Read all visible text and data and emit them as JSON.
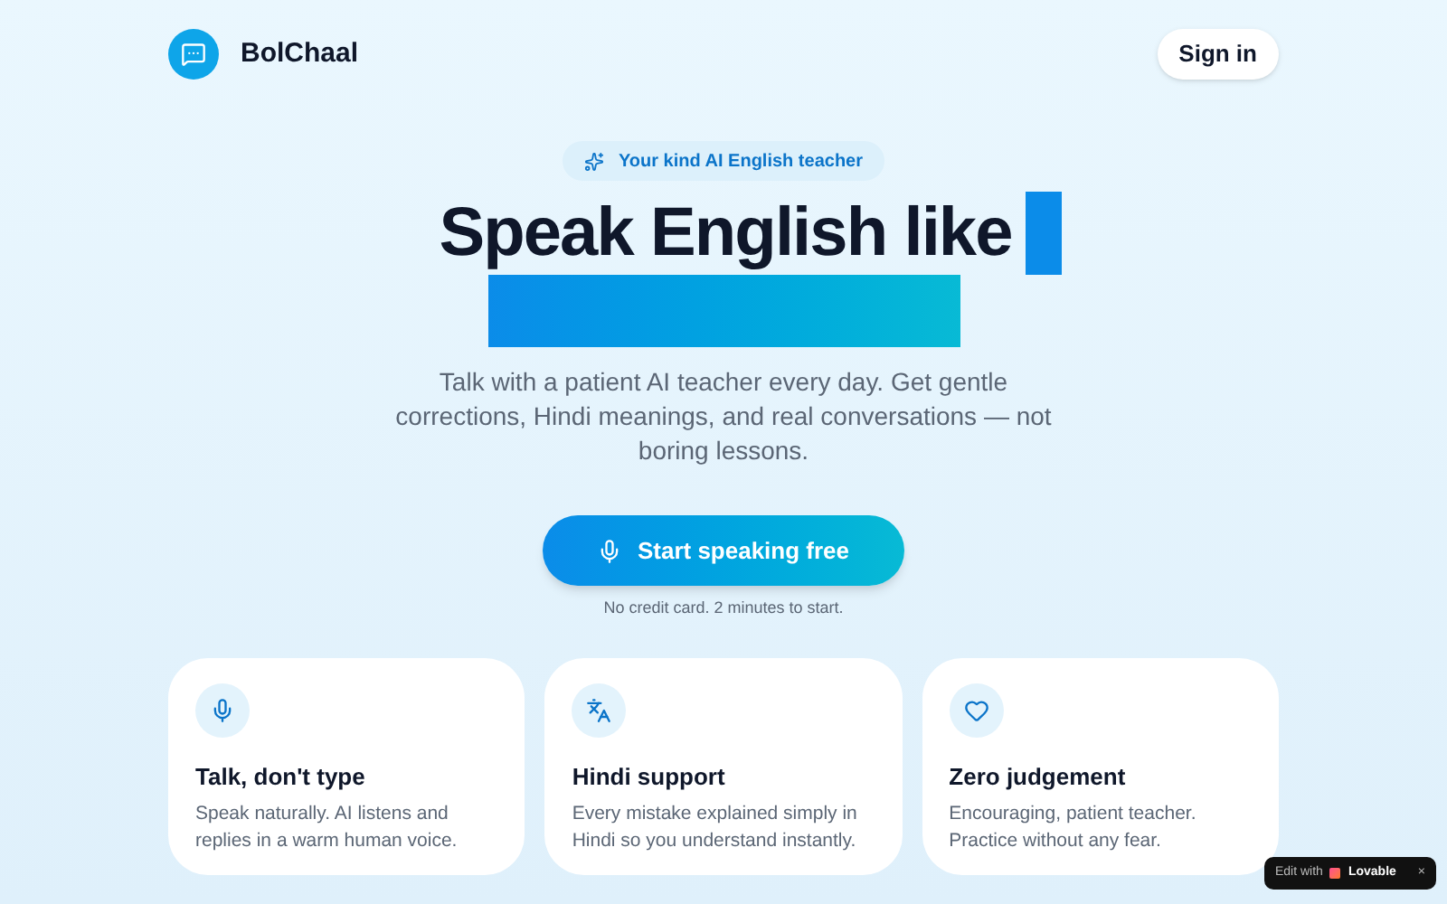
{
  "brand": {
    "name": "BolChaal"
  },
  "header": {
    "sign_in": "Sign in"
  },
  "hero": {
    "badge": "Your kind AI English teacher",
    "headline": "Speak English like",
    "subtitle": "Talk with a patient AI teacher every day. Get gentle corrections, Hindi meanings, and real conversations — not boring lessons.",
    "cta": "Start speaking free",
    "note": "No credit card. 2 minutes to start."
  },
  "features": [
    {
      "kind": "mic",
      "title": "Talk, don't type",
      "text": "Speak naturally. AI listens and replies in a warm human voice."
    },
    {
      "kind": "translate",
      "title": "Hindi support",
      "text": "Every mistake explained simply in Hindi so you understand instantly."
    },
    {
      "kind": "heart",
      "title": "Zero judgement",
      "text": "Encouraging, patient teacher. Practice without any fear."
    }
  ],
  "edit_badge": {
    "prefix": "Edit with",
    "brand": "Lovable",
    "close": "×"
  }
}
